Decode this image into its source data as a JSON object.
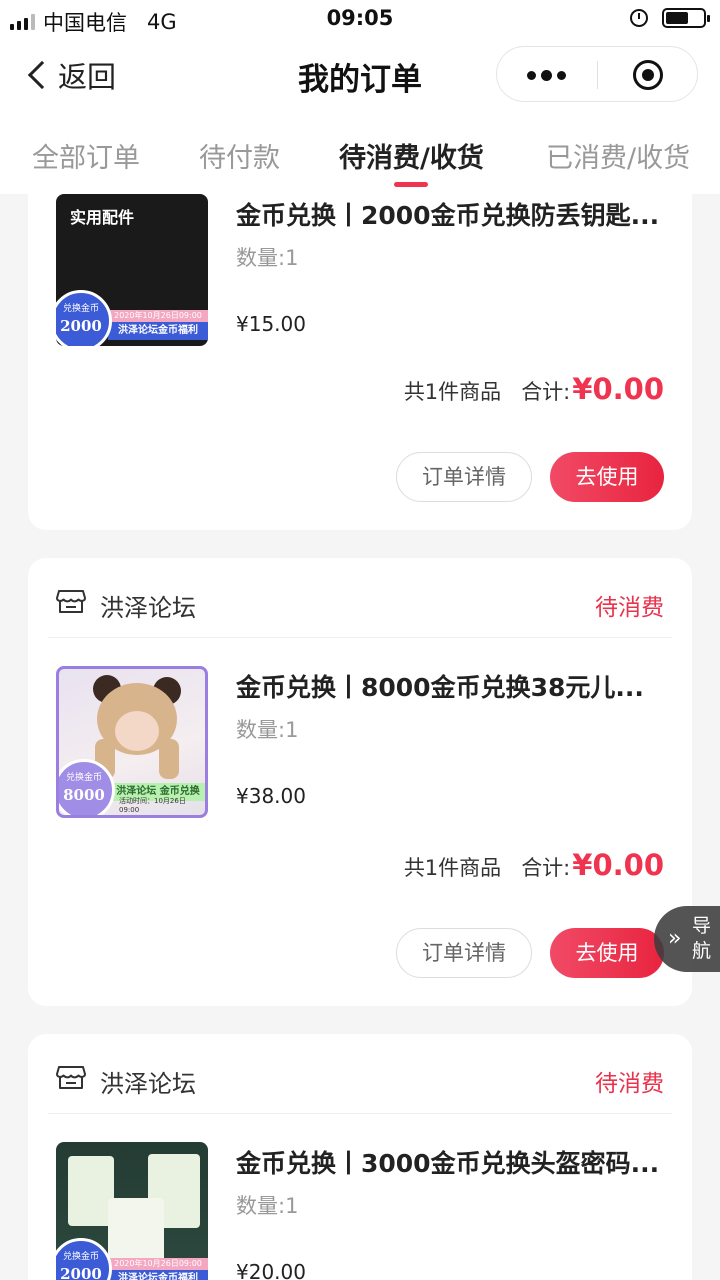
{
  "status_bar": {
    "carrier": "中国电信",
    "network": "4G",
    "time": "09:05"
  },
  "nav": {
    "back_label": "返回",
    "title": "我的订单"
  },
  "tabs": [
    {
      "label": "全部订单",
      "active": false
    },
    {
      "label": "待付款",
      "active": false
    },
    {
      "label": "待消费/收货",
      "active": true
    },
    {
      "label": "已消费/收货",
      "active": false
    }
  ],
  "orders": [
    {
      "shop": "",
      "status": "",
      "product": {
        "title": "金币兑换丨2000金币兑换防丢钥匙...",
        "quantity": "数量:1",
        "price": "¥15.00",
        "image": {
          "top_text": "实用配件",
          "badge_label": "兑换金币",
          "badge_value": "2000",
          "date": "2020年10月26日09:00",
          "ribbon": "洪泽论坛金币福利"
        }
      },
      "summary": {
        "count": "共1件商品",
        "total_label": "合计:",
        "total": "¥0.00"
      },
      "buttons": {
        "detail": "订单详情",
        "use": "去使用"
      }
    },
    {
      "shop": "洪泽论坛",
      "status": "待消费",
      "product": {
        "title": "金币兑换丨8000金币兑换38元儿...",
        "quantity": "数量:1",
        "price": "¥38.00",
        "image": {
          "badge_label": "兑换金币",
          "badge_value": "8000",
          "ribbon": "洪泽论坛 金币兑换",
          "date": "活动时间：10月26日09:00"
        }
      },
      "summary": {
        "count": "共1件商品",
        "total_label": "合计:",
        "total": "¥0.00"
      },
      "buttons": {
        "detail": "订单详情",
        "use": "去使用"
      }
    },
    {
      "shop": "洪泽论坛",
      "status": "待消费",
      "product": {
        "title": "金币兑换丨3000金币兑换头盔密码...",
        "quantity": "数量:1",
        "price": "¥20.00",
        "image": {
          "badge_label": "兑换金币",
          "badge_value": "2000",
          "date": "2020年10月26日09:00",
          "ribbon": "洪泽论坛金币福利"
        }
      }
    }
  ],
  "float_nav": {
    "label": "导航"
  },
  "colors": {
    "accent": "#f0334f",
    "status": "#e8334d",
    "background": "#f5f5f5"
  }
}
